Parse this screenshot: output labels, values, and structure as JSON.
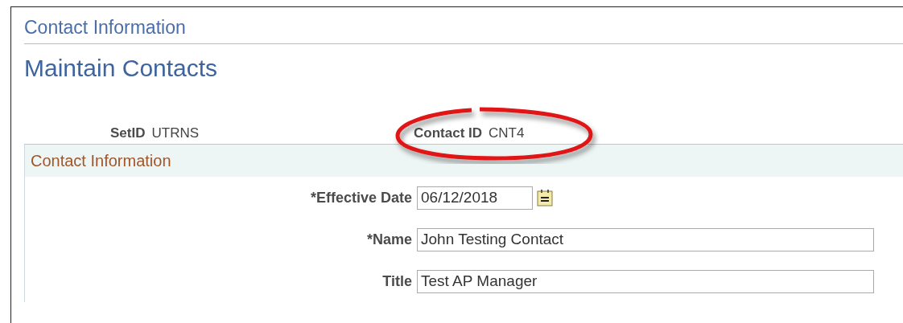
{
  "page_title": "Contact Information",
  "heading": "Maintain Contacts",
  "keys": [
    {
      "label": "SetID",
      "value": "UTRNS",
      "highlighted": false
    },
    {
      "label": "Contact ID",
      "value": "CNT4",
      "highlighted": true
    }
  ],
  "section": {
    "title": "Contact Information",
    "fields": [
      {
        "kind": "date",
        "label": "*Effective Date",
        "value": "06/12/2018"
      },
      {
        "kind": "text",
        "label": "*Name",
        "value": "John Testing Contact"
      },
      {
        "kind": "text",
        "label": "Title",
        "value": "Test AP Manager"
      }
    ]
  }
}
